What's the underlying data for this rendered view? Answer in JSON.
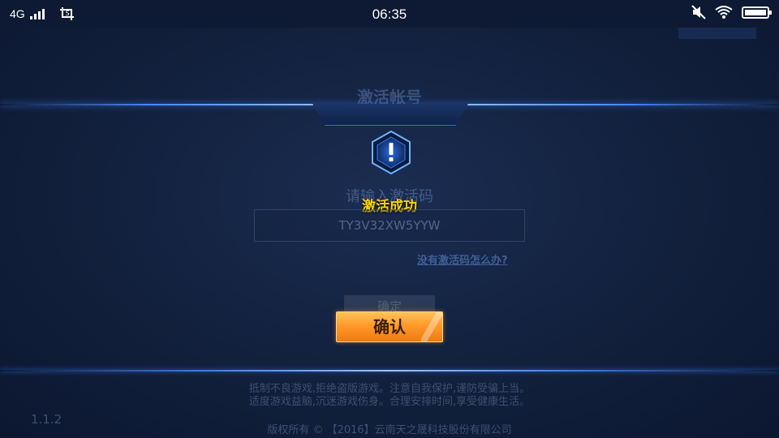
{
  "status_bar": {
    "network": "4G",
    "time": "06:35",
    "battery_level": 1.0
  },
  "dialog": {
    "title": "激活帐号",
    "prompt": "请输入激活码",
    "code_value": "TY3V32XW5YYW",
    "help_link": "没有激活码怎么办?",
    "ghost_button": "确定"
  },
  "toast": {
    "message": "激活成功",
    "confirm_label": "确认"
  },
  "footer": {
    "notice_line1": "抵制不良游戏,拒绝盗版游戏。注意自我保护,谨防受骗上当。",
    "notice_line2": "适度游戏益脑,沉迷游戏伤身。合理安排时间,享受健康生活。",
    "copyright": "版权所有 © 【2016】云南天之晟科技股份有限公司",
    "version": "1.1.2"
  },
  "colors": {
    "accent_yellow": "#ffd400",
    "confirm_orange": "#ff9a2a",
    "glow_blue": "#4b8bff"
  },
  "icons": [
    "signal-icon",
    "screenshot-icon",
    "mute-icon",
    "wifi-icon",
    "battery-icon",
    "warning-hexagon-icon"
  ]
}
